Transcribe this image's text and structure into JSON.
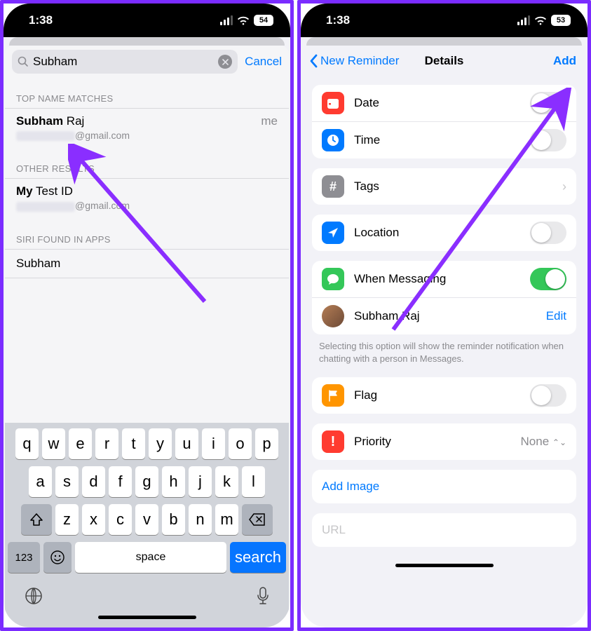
{
  "screen1": {
    "status": {
      "time": "1:38",
      "battery": "54"
    },
    "search": {
      "value": "Subham",
      "cancel": "Cancel"
    },
    "sections": {
      "topName": {
        "label": "TOP NAME MATCHES",
        "item": {
          "nameBold": "Subham",
          "nameRest": " Raj",
          "emailSuffix": "@gmail.com",
          "meTag": "me"
        }
      },
      "other": {
        "label": "OTHER RESULTS",
        "item": {
          "nameBold": "My",
          "nameRest": " Test ID",
          "emailSuffix": "@gmail.com"
        }
      },
      "siri": {
        "label": "SIRI FOUND IN APPS",
        "item": "Subham"
      }
    },
    "keyboard": {
      "row1": [
        "q",
        "w",
        "e",
        "r",
        "t",
        "y",
        "u",
        "i",
        "o",
        "p"
      ],
      "row2": [
        "a",
        "s",
        "d",
        "f",
        "g",
        "h",
        "j",
        "k",
        "l"
      ],
      "row3": [
        "z",
        "x",
        "c",
        "v",
        "b",
        "n",
        "m"
      ],
      "numKey": "123",
      "space": "space",
      "search": "search"
    }
  },
  "screen2": {
    "status": {
      "time": "1:38",
      "battery": "53"
    },
    "nav": {
      "back": "New Reminder",
      "title": "Details",
      "add": "Add"
    },
    "rows": {
      "date": "Date",
      "time": "Time",
      "tags": "Tags",
      "location": "Location",
      "whenMessaging": "When Messaging",
      "contactName": "Subham Raj",
      "edit": "Edit",
      "footnote": "Selecting this option will show the reminder notification when chatting with a person in Messages.",
      "flag": "Flag",
      "priority": "Priority",
      "priorityValue": "None",
      "addImage": "Add Image",
      "url": "URL"
    }
  }
}
